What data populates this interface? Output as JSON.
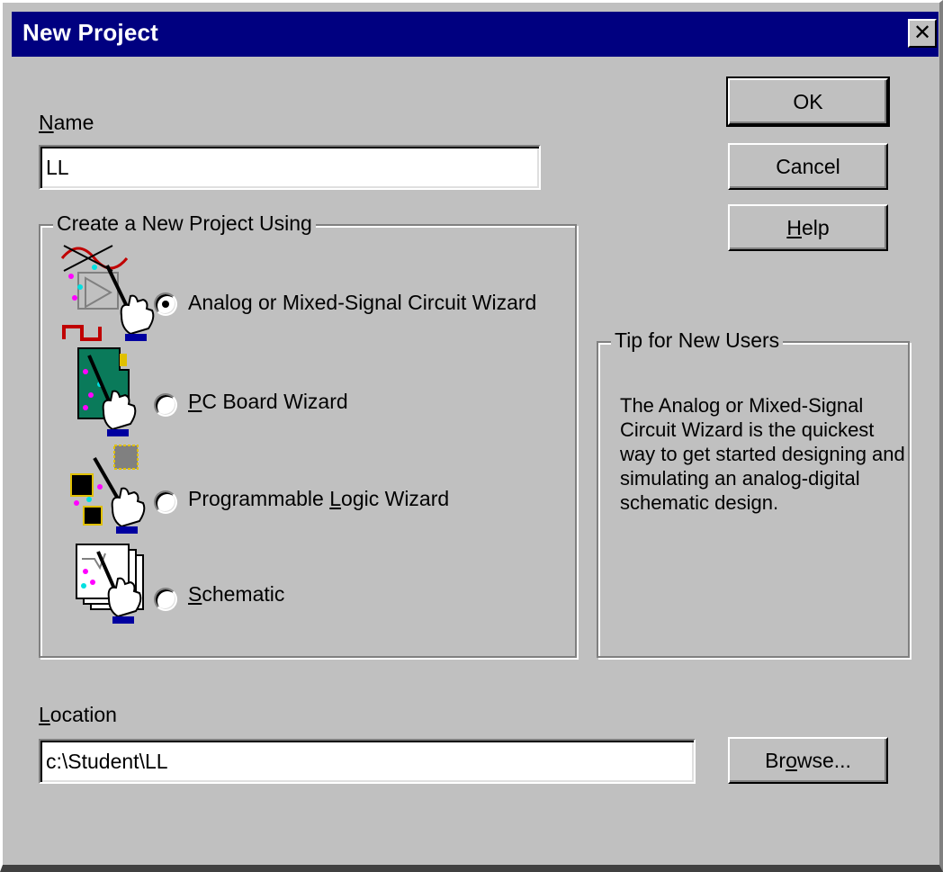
{
  "window": {
    "title": "New Project",
    "close_glyph": "✕"
  },
  "name_field": {
    "label_prefix": "",
    "label_accel": "N",
    "label_rest": "ame",
    "value": "LL"
  },
  "buttons": {
    "ok": "OK",
    "cancel": "Cancel",
    "help_accel": "H",
    "help_rest": "elp",
    "browse_prefix": "Br",
    "browse_accel": "o",
    "browse_rest": "wse..."
  },
  "project_group": {
    "title": "Create a New Project Using",
    "options": [
      {
        "prefix": "",
        "accel": "",
        "rest": "Analog or Mixed-Signal Circuit Wizard",
        "selected": true,
        "icon": "analog-wizard-icon"
      },
      {
        "prefix": "",
        "accel": "P",
        "rest": "C Board Wizard",
        "selected": false,
        "icon": "pc-board-wizard-icon"
      },
      {
        "prefix": "Programmable ",
        "accel": "L",
        "rest": "ogic Wizard",
        "selected": false,
        "icon": "programmable-logic-wizard-icon"
      },
      {
        "prefix": "",
        "accel": "S",
        "rest": "chematic",
        "selected": false,
        "icon": "schematic-icon"
      }
    ]
  },
  "tip_group": {
    "title": "Tip for New Users",
    "text": "The Analog or Mixed-Signal Circuit Wizard is the quickest way to get started designing and simulating an analog-digital schematic design."
  },
  "location_field": {
    "label_prefix": "",
    "label_accel": "L",
    "label_rest": "ocation",
    "value": "c:\\Student\\LL"
  },
  "colors": {
    "titlebar": "#000080",
    "face": "#c0c0c0"
  }
}
